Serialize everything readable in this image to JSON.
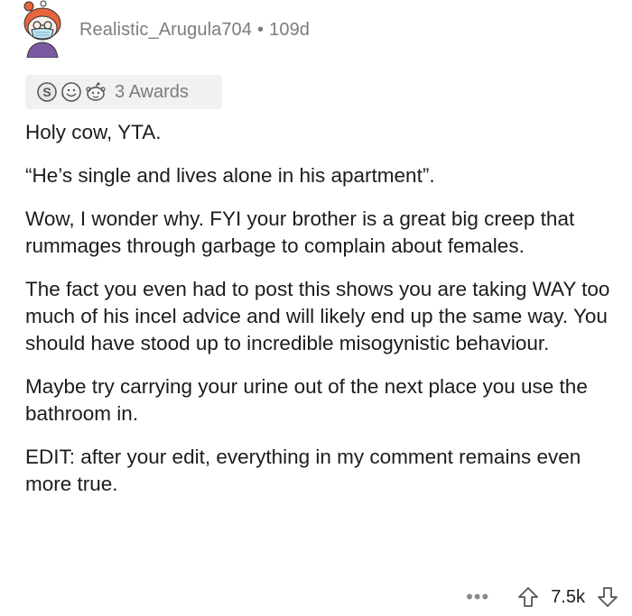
{
  "post": {
    "username": "Realistic_Arugula704",
    "separator": "•",
    "age": "109d",
    "avatar_icon": "snoo-avatar-icon"
  },
  "awards": {
    "icons": [
      "silver-award-icon",
      "wholesome-award-icon",
      "helpful-award-icon"
    ],
    "label": "3 Awards"
  },
  "comment": {
    "paragraphs": [
      "Holy cow, YTA.",
      "“He’s single and lives alone in his apartment”.",
      "Wow, I wonder why. FYI your brother is a great big creep that rummages through garbage to complain about females.",
      "The fact you even had to post this shows you are taking WAY too much of his incel advice and will likely end up the same way. You should have stood up to incredible misogynistic behaviour.",
      "Maybe try carrying your urine out of the next place you use the bathroom in.",
      "EDIT: after your edit, everything in my comment remains even more true."
    ]
  },
  "footer": {
    "more_label": "•••",
    "score": "7.5k",
    "upvote_icon": "upvote-arrow-icon",
    "downvote_icon": "downvote-arrow-icon"
  },
  "colors": {
    "meta_gray": "#7c7c7c",
    "text": "#1c1c1c",
    "award_bg": "#f1f1f1",
    "avatar_orange": "#e8643c"
  }
}
